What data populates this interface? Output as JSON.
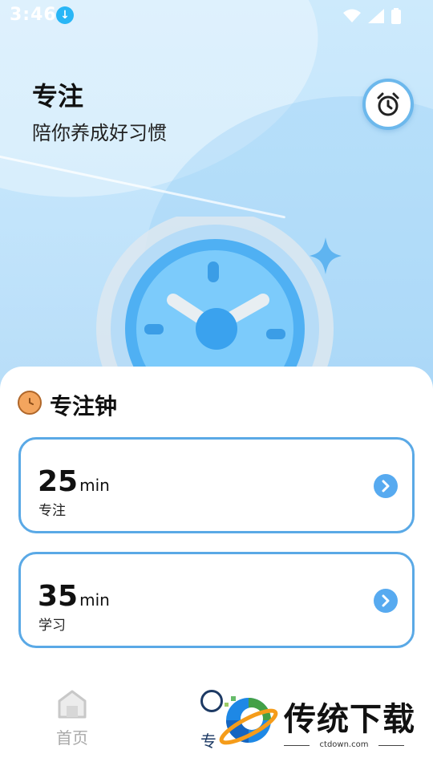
{
  "status_bar": {
    "time": "3:46"
  },
  "header": {
    "title": "专注",
    "subtitle": "陪你养成好习惯"
  },
  "section": {
    "title": "专注钟"
  },
  "timers": [
    {
      "value": "25",
      "unit": "min",
      "label": "专注"
    },
    {
      "value": "35",
      "unit": "min",
      "label": "学习"
    }
  ],
  "tabbar": {
    "home_label": "首页",
    "focus_label": "专"
  },
  "watermark": {
    "brand": "传统下载",
    "url": "ctdown.com"
  },
  "colors": {
    "accent": "#5aa9e6",
    "arrow_button": "#57aaf0",
    "sky": "#c2e4fb",
    "section_icon": "#f3a55e"
  }
}
